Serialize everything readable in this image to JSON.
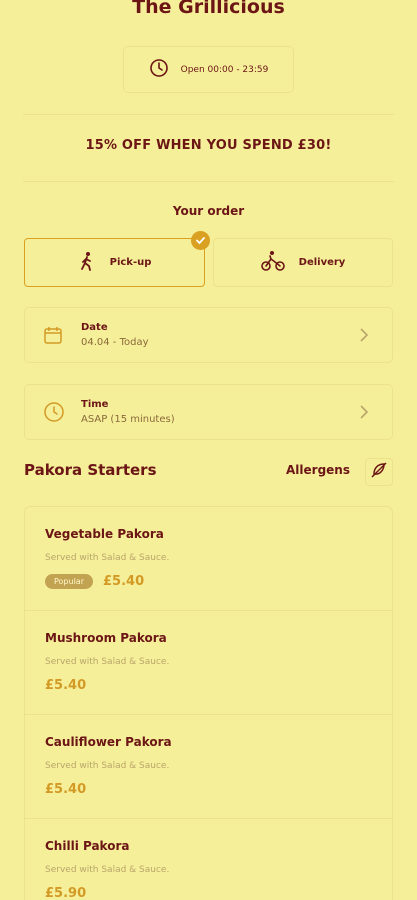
{
  "header": {
    "title": "The Grillicious",
    "hours": "Open 00:00 - 23:59"
  },
  "promo": "15% OFF WHEN YOU SPEND £30!",
  "order": {
    "title": "Your order",
    "modes": [
      {
        "label": "Pick-up",
        "selected": true,
        "icon": "walking-person-icon"
      },
      {
        "label": "Delivery",
        "selected": false,
        "icon": "bicycle-icon"
      }
    ],
    "date": {
      "label": "Date",
      "value": "04.04 - Today"
    },
    "time": {
      "label": "Time",
      "value": "ASAP (15 minutes)"
    }
  },
  "section": {
    "title": "Pakora Starters",
    "allergens_label": "Allergens"
  },
  "items": [
    {
      "name": "Vegetable Pakora",
      "desc": "Served with Salad & Sauce.",
      "badge": "Popular",
      "price": "£5.40"
    },
    {
      "name": "Mushroom Pakora",
      "desc": "Served with Salad & Sauce.",
      "price": "£5.40"
    },
    {
      "name": "Cauliflower Pakora",
      "desc": "Served with Salad & Sauce.",
      "price": "£5.40"
    },
    {
      "name": "Chilli Pakora",
      "desc": "Served with Salad & Sauce.",
      "price": "£5.90"
    }
  ],
  "colors": {
    "background": "#f6ef9a",
    "primary": "#6b1515",
    "accent": "#d9a021",
    "price": "#d39a25"
  }
}
